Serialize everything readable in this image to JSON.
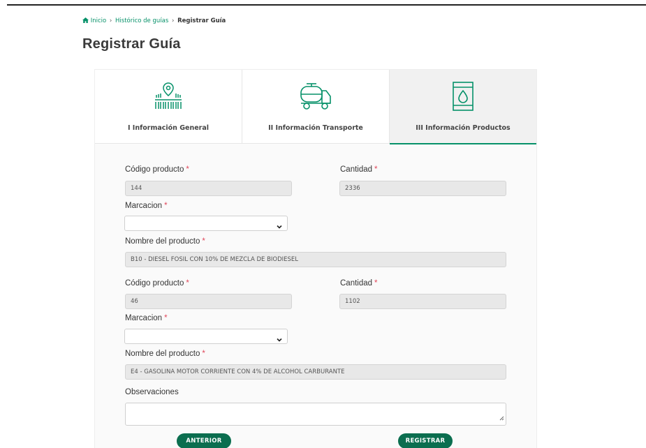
{
  "breadcrumb": {
    "items": [
      "Inicio",
      "Histórico de guías"
    ],
    "separator": "›",
    "current": "Registrar Guía"
  },
  "page": {
    "title": "Registrar Guía"
  },
  "steps": [
    {
      "label": "I Información General",
      "icon": "map-pin-barcode-icon"
    },
    {
      "label": "II Información Transporte",
      "icon": "tanker-truck-icon"
    },
    {
      "label": "III Información Productos",
      "icon": "oil-barrel-icon",
      "active": true
    }
  ],
  "products": [
    {
      "codigo_label": "Código producto",
      "codigo_value": "144",
      "cantidad_label": "Cantidad",
      "cantidad_value": "2336",
      "marcacion_label": "Marcacion",
      "marcacion_value": "",
      "nombre_label": "Nombre del producto",
      "nombre_value": "B10 - DIESEL FOSIL CON 10% DE MEZCLA DE BIODIESEL"
    },
    {
      "codigo_label": "Código producto",
      "codigo_value": "46",
      "cantidad_label": "Cantidad",
      "cantidad_value": "1102",
      "marcacion_label": "Marcacion",
      "marcacion_value": "",
      "nombre_label": "Nombre del producto",
      "nombre_value": "E4 - GASOLINA MOTOR CORRIENTE CON 4% DE ALCOHOL CARBURANTE"
    }
  ],
  "required_marker": "*",
  "observaciones": {
    "label": "Observaciones",
    "value": ""
  },
  "buttons": {
    "anterior": "ANTERIOR",
    "registrar": "REGISTRAR"
  },
  "colors": {
    "accent": "#069169",
    "button": "#0b6e4f",
    "required": "#e0475a"
  }
}
